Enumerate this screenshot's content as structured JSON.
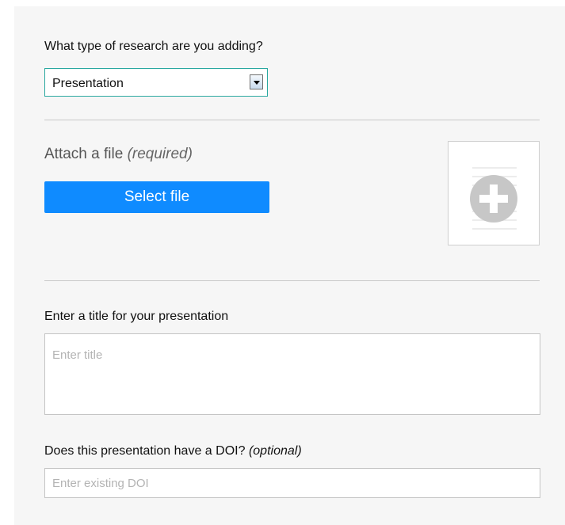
{
  "research_type": {
    "question": "What type of research are you adding?",
    "selected": "Presentation"
  },
  "attach": {
    "label": "Attach a file",
    "required": "(required)",
    "button_label": "Select file"
  },
  "title_field": {
    "label": "Enter a title for your presentation",
    "placeholder": "Enter title"
  },
  "doi_field": {
    "label": "Does this presentation have a DOI?",
    "optional": "(optional)",
    "placeholder": "Enter existing DOI"
  },
  "icons": {
    "dropdown": "chevron-down-icon",
    "upload": "add-file-icon"
  },
  "colors": {
    "accent": "#0f8bff",
    "select_border": "#2aa8a0"
  }
}
